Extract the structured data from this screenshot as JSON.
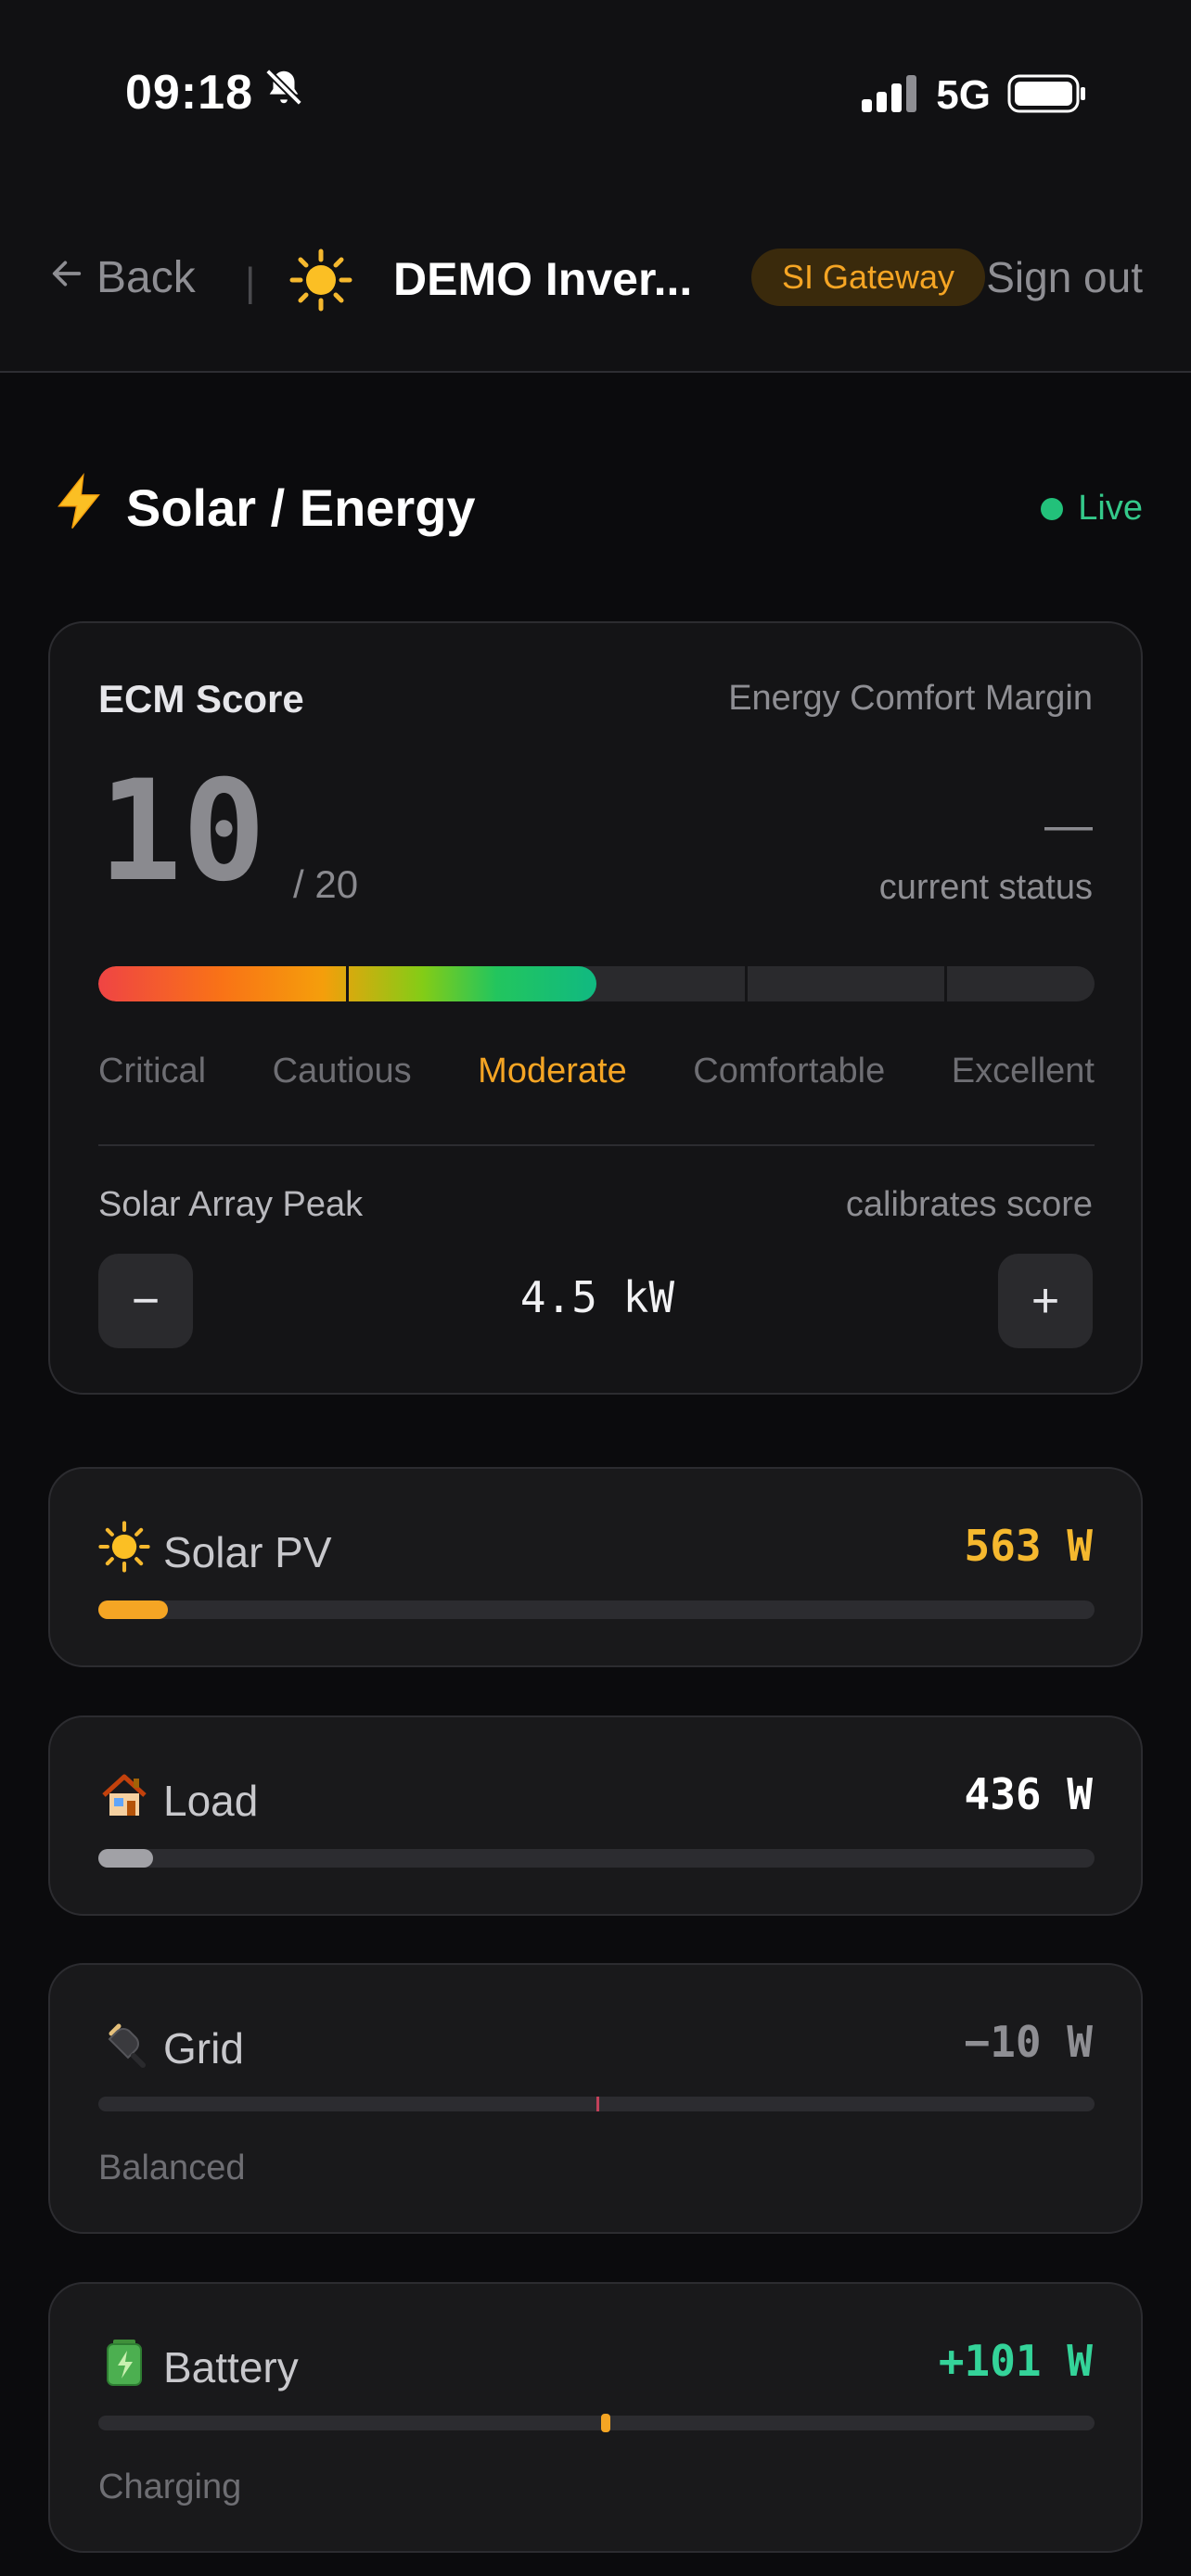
{
  "statusbar": {
    "time": "09:18",
    "network": "5G"
  },
  "header": {
    "back_label": "Back",
    "separator": "|",
    "device_name": "DEMO Inver...",
    "gateway_badge": "SI Gateway",
    "signout_label": "Sign out"
  },
  "section": {
    "title": "Solar / Energy",
    "live_label": "Live"
  },
  "ecm": {
    "title": "ECM Score",
    "subtitle": "Energy Comfort Margin",
    "score": "10",
    "score_max": "/ 20",
    "score_value": 10,
    "score_total": 20,
    "status_value": "—",
    "status_label": "current status",
    "levels": [
      "Critical",
      "Cautious",
      "Moderate",
      "Comfortable",
      "Excellent"
    ],
    "active_level": "Moderate",
    "peak_label": "Solar Array Peak",
    "peak_hint": "calibrates score",
    "minus_label": "−",
    "plus_label": "+",
    "peak_value": "4.5 kW"
  },
  "metrics": {
    "solar": {
      "label": "Solar PV",
      "value": "563 W",
      "color": "#f5b82e",
      "bar_fill_fraction": 0.07
    },
    "load": {
      "label": "Load",
      "value": "436 W",
      "color": "#ffffff",
      "bar_fill_fraction": 0.055
    },
    "grid": {
      "label": "Grid",
      "value": "−10 W",
      "color": "#8e8e93",
      "status": "Balanced",
      "marker_fraction": 0.5
    },
    "battery": {
      "label": "Battery",
      "value": "+101 W",
      "color": "#34d399",
      "status": "Charging",
      "marker_fraction": 0.505
    }
  },
  "colors": {
    "accent": "#f5a524",
    "live": "#22c17a",
    "background": "#0b0b0d"
  },
  "icons": [
    "bell-slash-icon",
    "signal-icon",
    "battery-icon",
    "arrow-left-icon",
    "sun-icon",
    "bolt-icon",
    "house-icon",
    "plug-icon",
    "battery-charging-icon"
  ]
}
